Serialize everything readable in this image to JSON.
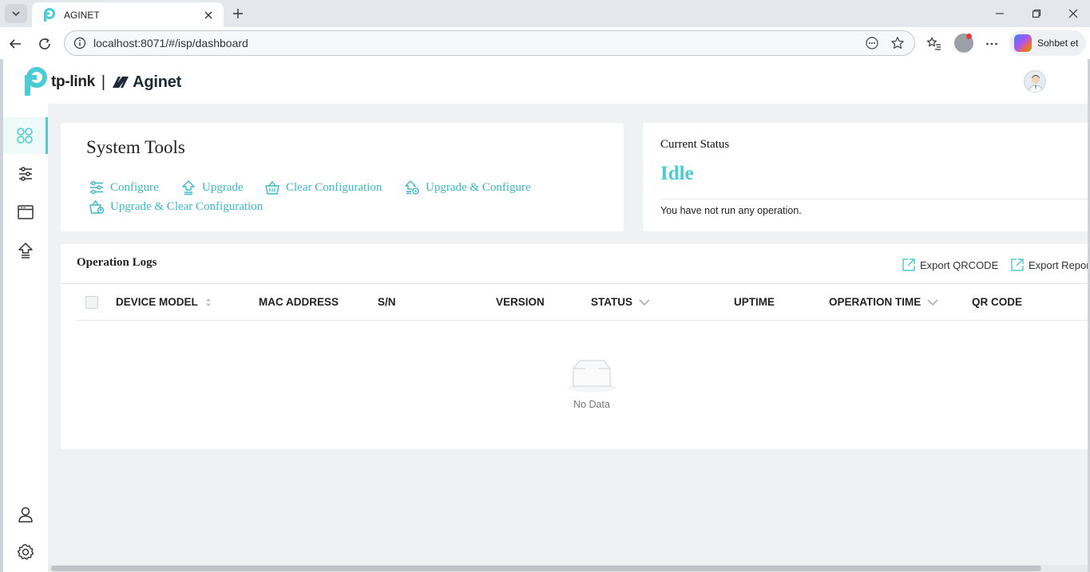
{
  "browser": {
    "tab_title": "AGINET",
    "url": "localhost:8071/#/isp/dashboard",
    "copilot_label": "Sohbet et"
  },
  "header": {
    "brand_tp": "tp-link",
    "brand_sep": "|",
    "brand_aginet": "Aginet"
  },
  "sidebar": {
    "items": [
      {
        "name": "dashboard",
        "icon": "grid-icon",
        "active": true
      },
      {
        "name": "settings",
        "icon": "sliders-icon",
        "active": false
      },
      {
        "name": "devices",
        "icon": "window-icon",
        "active": false
      },
      {
        "name": "upgrade",
        "icon": "upload-icon",
        "active": false
      },
      {
        "name": "account",
        "icon": "user-icon",
        "active": false
      },
      {
        "name": "system",
        "icon": "gear-icon",
        "active": false
      }
    ]
  },
  "system_tools": {
    "title": "System Tools",
    "actions": {
      "configure": "Configure",
      "upgrade": "Upgrade",
      "clear_configuration": "Clear Configuration",
      "upgrade_configure": "Upgrade & Configure",
      "upgrade_clear_configuration": "Upgrade & Clear Configuration"
    }
  },
  "current_status": {
    "label": "Current Status",
    "value": "Idle",
    "message": "You have not run any operation."
  },
  "operation_logs": {
    "title": "Operation Logs",
    "export_qrcode": "Export QRCODE",
    "export_report": "Export Repor",
    "columns": {
      "device_model": "DEVICE MODEL",
      "mac_address": "MAC ADDRESS",
      "sn": "S/N",
      "version": "VERSION",
      "status": "STATUS",
      "uptime": "UPTIME",
      "operation_time": "OPERATION TIME",
      "qr_code": "QR CODE"
    },
    "rows": [],
    "empty_text": "No Data"
  },
  "colors": {
    "accent": "#4acbd6",
    "link": "#3ab8c6",
    "background": "#f0f1f3"
  }
}
